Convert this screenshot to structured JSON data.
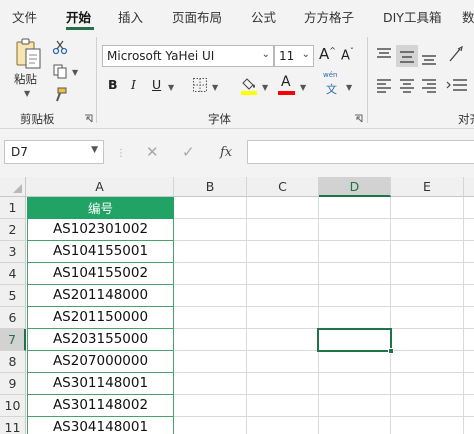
{
  "tabs": [
    "文件",
    "开始",
    "插入",
    "页面布局",
    "公式",
    "方方格子",
    "DIY工具箱",
    "数"
  ],
  "active_tab": "开始",
  "ribbon": {
    "clipboard": {
      "paste_label": "粘贴",
      "group_label": "剪贴板"
    },
    "font": {
      "font_name": "Microsoft YaHei UI",
      "font_size": "11",
      "grow_label": "A",
      "shrink_label": "A",
      "bold": "B",
      "italic": "I",
      "underline": "U",
      "font_color_label": "A",
      "phonetic_top": "wén",
      "phonetic_bottom": "文",
      "group_label": "字体",
      "highlight_color": "#ffff00",
      "font_color": "#ff0000"
    },
    "alignment": {
      "group_label": "对齐"
    }
  },
  "formula_bar": {
    "name_box": "D7",
    "fx": "fx",
    "formula": ""
  },
  "grid": {
    "columns": [
      "A",
      "B",
      "C",
      "D",
      "E"
    ],
    "rows": [
      "1",
      "2",
      "3",
      "4",
      "5",
      "6",
      "7",
      "8",
      "9",
      "10",
      "11"
    ],
    "selected_cell": "D7",
    "column_a": [
      "编号",
      "AS102301002",
      "AS104155001",
      "AS104155002",
      "AS201148000",
      "AS201150000",
      "AS203155000",
      "AS207000000",
      "AS301148001",
      "AS301148002",
      "AS304148001"
    ]
  },
  "colors": {
    "accent": "#217346",
    "header_fill": "#21a366"
  }
}
